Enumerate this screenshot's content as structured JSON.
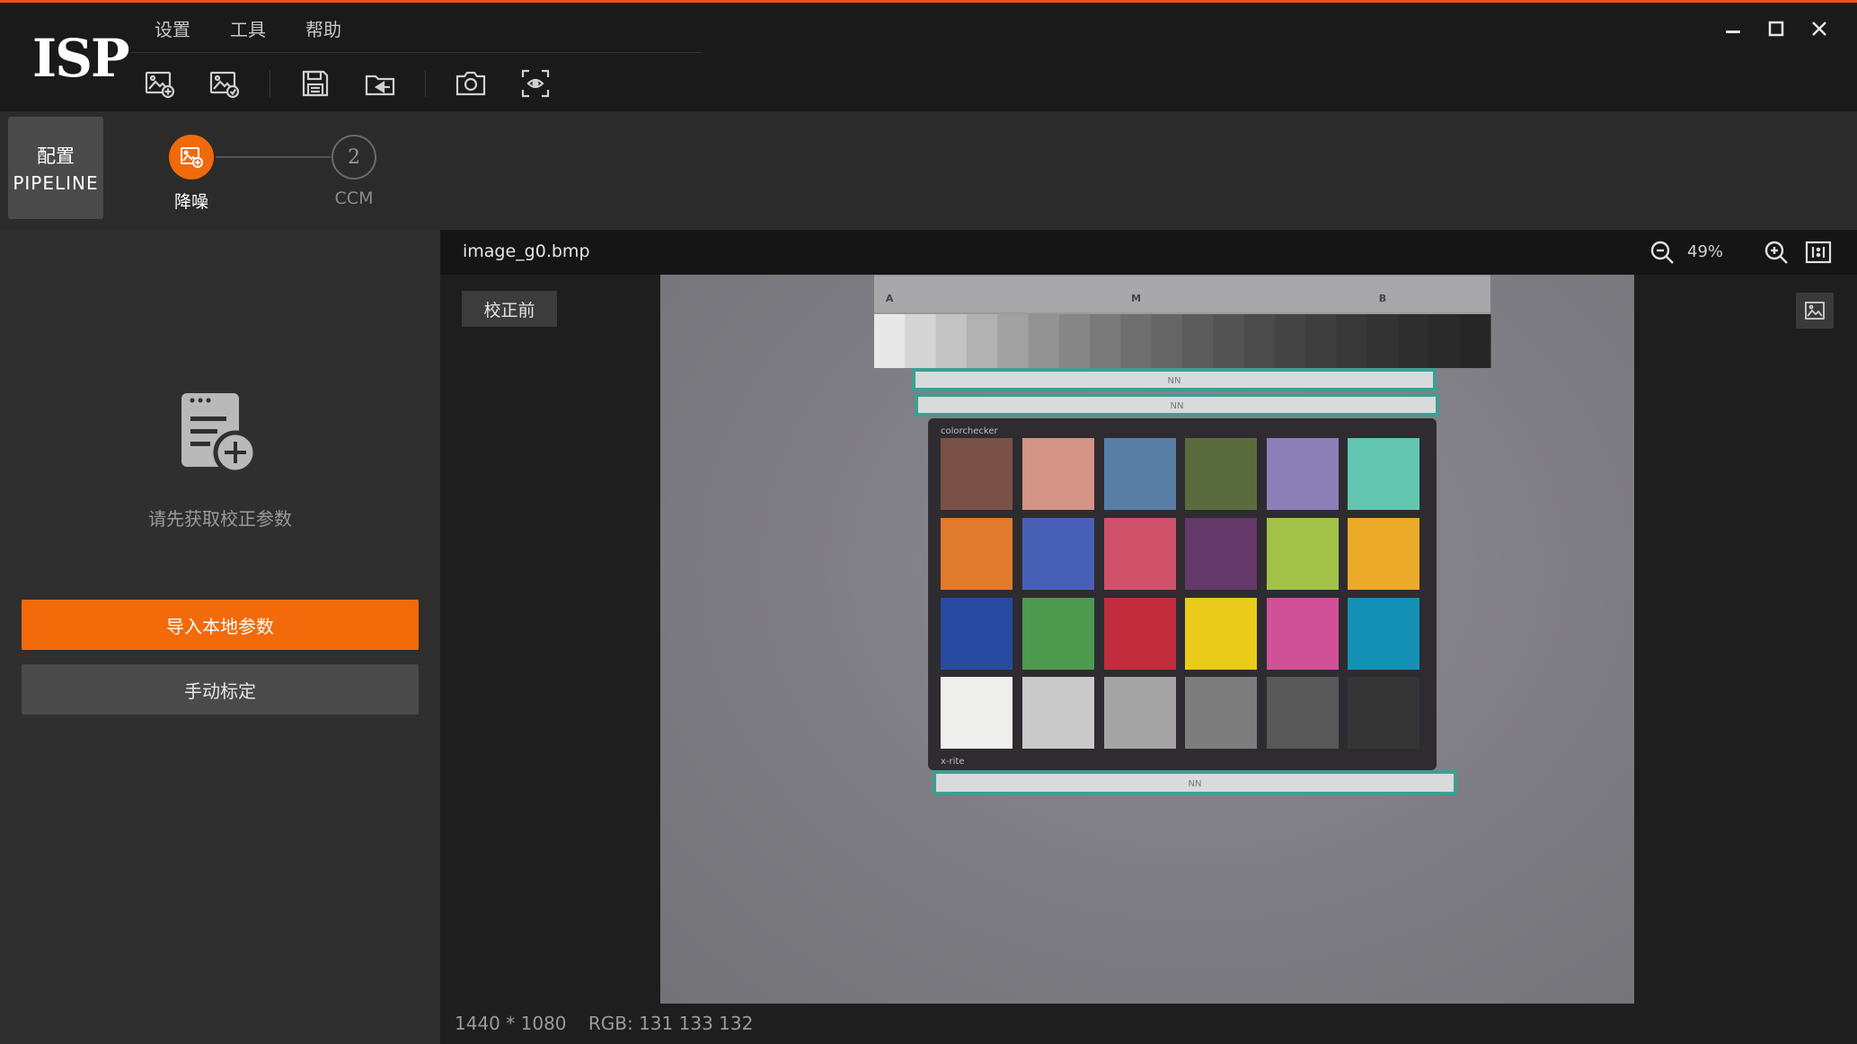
{
  "app": {
    "logo": "ISP"
  },
  "menu": [
    "设置",
    "工具",
    "帮助"
  ],
  "toolbar": {
    "icons": [
      "import-image-icon",
      "export-image-icon",
      "save-icon",
      "load-icon",
      "camera-icon",
      "scan-icon"
    ]
  },
  "window": {
    "icons": [
      "minimize-icon",
      "maximize-icon",
      "close-icon"
    ]
  },
  "pipeline": {
    "button_line1": "配置",
    "button_line2": "PIPELINE",
    "steps": [
      {
        "number": "",
        "label": "降噪",
        "active": true
      },
      {
        "number": "2",
        "label": "CCM",
        "active": false
      }
    ]
  },
  "left_panel": {
    "hint": "请先获取校正参数",
    "import_label": "导入本地参数",
    "manual_label": "手动标定"
  },
  "viewer": {
    "filename": "image_g0.bmp",
    "zoom": "49%",
    "before_tag": "校正前",
    "status_size": "1440 * 1080",
    "status_rgb": "RGB: 131 133 132"
  },
  "chart": {
    "scale_letters": [
      "A",
      "M",
      "B"
    ],
    "brand": "colorchecker",
    "logo_text": "x-rite",
    "strip_text": "NN",
    "patches": [
      [
        "#7a5146",
        "#d39486",
        "#587ea6",
        "#5a6b3e",
        "#8a7fb7",
        "#62c6b0"
      ],
      [
        "#e07a2c",
        "#4760b5",
        "#d0516a",
        "#643868",
        "#a2c24a",
        "#ecaa2a"
      ],
      [
        "#284aa0",
        "#4e9a4e",
        "#c12d3c",
        "#eacb1a",
        "#d05198",
        "#1591b6"
      ],
      [
        "#eeeeec",
        "#c9c9c9",
        "#a4a4a4",
        "#7d7d7d",
        "#585858",
        "#353535"
      ]
    ],
    "grayscale": [
      "#e8e8e8",
      "#d5d5d5",
      "#c3c3c3",
      "#b2b2b2",
      "#a2a2a2",
      "#939393",
      "#868686",
      "#7a7a7a",
      "#6f6f6f",
      "#656565",
      "#5c5c5c",
      "#535353",
      "#4b4b4b",
      "#444444",
      "#3e3e3e",
      "#383838",
      "#333333",
      "#2e2e2e",
      "#2a2a2a",
      "#262626"
    ]
  }
}
